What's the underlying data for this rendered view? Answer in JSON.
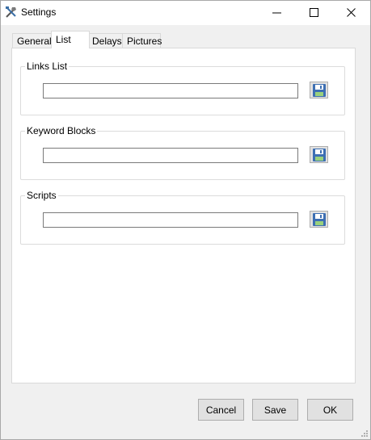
{
  "window": {
    "title": "Settings"
  },
  "tabs": [
    {
      "label": "General",
      "active": false
    },
    {
      "label": "List",
      "active": true
    },
    {
      "label": "Delays",
      "active": false
    },
    {
      "label": "Pictures",
      "active": false
    }
  ],
  "groups": [
    {
      "label": "Links List",
      "value": ""
    },
    {
      "label": "Keyword Blocks",
      "value": ""
    },
    {
      "label": "Scripts",
      "value": ""
    }
  ],
  "buttons": {
    "cancel": "Cancel",
    "save": "Save",
    "ok": "OK"
  },
  "colors": {
    "floppy_blue": "#3d6fb3",
    "floppy_label": "#9ad17c",
    "window_bg": "#f0f0f0"
  }
}
